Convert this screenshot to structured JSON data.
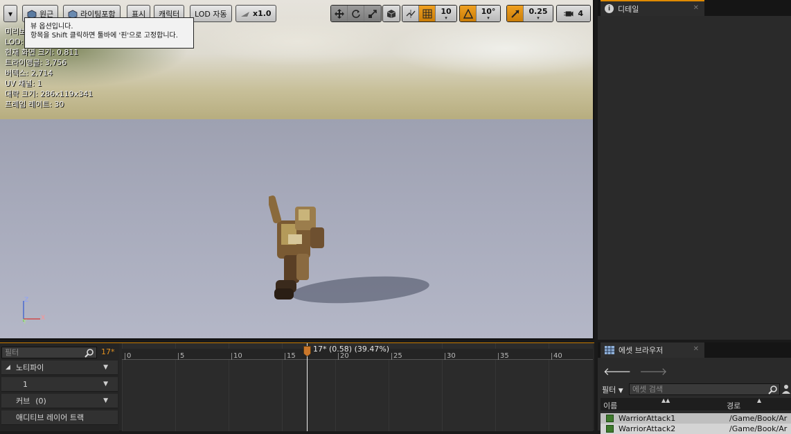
{
  "toolbar": {
    "view_options_caret": "▾",
    "perspective_label": "원근",
    "lighting_label": "라이팅포함",
    "show_label": "표시",
    "character_label": "캐릭터",
    "lod_label": "LOD 자동",
    "speed_label": "x1.0",
    "grid_snap_value": "10",
    "rotation_snap_value": "10°",
    "scale_snap_value": "0.25",
    "camera_speed_value": "4"
  },
  "tooltip": {
    "line1": "뷰 옵션입니다.",
    "line2": "항목을 Shift 클릭하면 툴바에 '핀'으로 고정합니다."
  },
  "stats": {
    "line0": "미리보",
    "line1": "LOD:",
    "line2": "현재 화면 크기: 0.811",
    "line3": "트라이앵글: 3,756",
    "line4": "버텍스: 2,714",
    "line5": "UV 채널: 1",
    "line6": "대략 크기: 286x119x341",
    "line7": "프레임 레이트: 30"
  },
  "axis": {
    "z": "Z",
    "y": "Y",
    "x": "X"
  },
  "details_panel": {
    "tab_label": "디테일"
  },
  "timeline": {
    "filter_placeholder": "필터",
    "current_frame": "17*",
    "playhead_label": "17* (0.58) (39.47%)",
    "ticks": [
      "0",
      "5",
      "10",
      "15",
      "20",
      "25",
      "30",
      "35",
      "40"
    ],
    "tracks": {
      "notify": "노티파이",
      "notify_track": "1",
      "curves": "커브",
      "curves_count": "(0)",
      "additive": "애디티브 레이어 트랙"
    }
  },
  "content_browser": {
    "tab_label": "에셋 브라우저",
    "filter_label": "필터",
    "search_placeholder": "에셋 검색",
    "col_name": "이름",
    "col_path": "경로",
    "rows": [
      {
        "name": "WarriorAttack1",
        "path": "/Game/Book/Ar"
      },
      {
        "name": "WarriorAttack2",
        "path": "/Game/Book/Ar"
      }
    ]
  },
  "colors": {
    "accent": "#e08a00",
    "panel": "#2a2a2a",
    "selection_row": "#bfbfbf"
  }
}
